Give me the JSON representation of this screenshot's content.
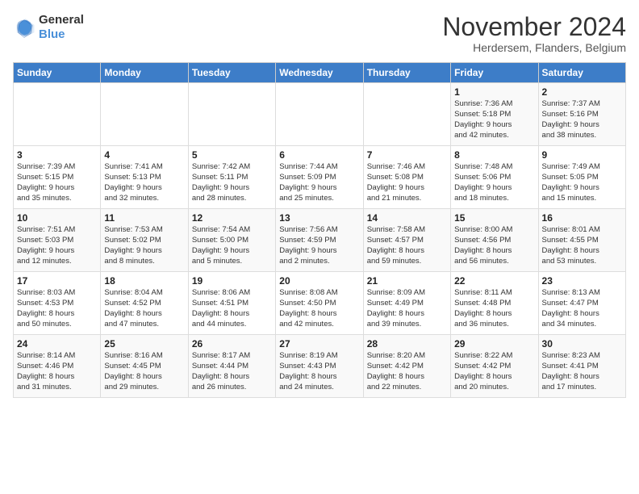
{
  "logo": {
    "line1": "General",
    "line2": "Blue"
  },
  "title": "November 2024",
  "subtitle": "Herdersem, Flanders, Belgium",
  "days_of_week": [
    "Sunday",
    "Monday",
    "Tuesday",
    "Wednesday",
    "Thursday",
    "Friday",
    "Saturday"
  ],
  "weeks": [
    [
      {
        "day": "",
        "info": ""
      },
      {
        "day": "",
        "info": ""
      },
      {
        "day": "",
        "info": ""
      },
      {
        "day": "",
        "info": ""
      },
      {
        "day": "",
        "info": ""
      },
      {
        "day": "1",
        "info": "Sunrise: 7:36 AM\nSunset: 5:18 PM\nDaylight: 9 hours\nand 42 minutes."
      },
      {
        "day": "2",
        "info": "Sunrise: 7:37 AM\nSunset: 5:16 PM\nDaylight: 9 hours\nand 38 minutes."
      }
    ],
    [
      {
        "day": "3",
        "info": "Sunrise: 7:39 AM\nSunset: 5:15 PM\nDaylight: 9 hours\nand 35 minutes."
      },
      {
        "day": "4",
        "info": "Sunrise: 7:41 AM\nSunset: 5:13 PM\nDaylight: 9 hours\nand 32 minutes."
      },
      {
        "day": "5",
        "info": "Sunrise: 7:42 AM\nSunset: 5:11 PM\nDaylight: 9 hours\nand 28 minutes."
      },
      {
        "day": "6",
        "info": "Sunrise: 7:44 AM\nSunset: 5:09 PM\nDaylight: 9 hours\nand 25 minutes."
      },
      {
        "day": "7",
        "info": "Sunrise: 7:46 AM\nSunset: 5:08 PM\nDaylight: 9 hours\nand 21 minutes."
      },
      {
        "day": "8",
        "info": "Sunrise: 7:48 AM\nSunset: 5:06 PM\nDaylight: 9 hours\nand 18 minutes."
      },
      {
        "day": "9",
        "info": "Sunrise: 7:49 AM\nSunset: 5:05 PM\nDaylight: 9 hours\nand 15 minutes."
      }
    ],
    [
      {
        "day": "10",
        "info": "Sunrise: 7:51 AM\nSunset: 5:03 PM\nDaylight: 9 hours\nand 12 minutes."
      },
      {
        "day": "11",
        "info": "Sunrise: 7:53 AM\nSunset: 5:02 PM\nDaylight: 9 hours\nand 8 minutes."
      },
      {
        "day": "12",
        "info": "Sunrise: 7:54 AM\nSunset: 5:00 PM\nDaylight: 9 hours\nand 5 minutes."
      },
      {
        "day": "13",
        "info": "Sunrise: 7:56 AM\nSunset: 4:59 PM\nDaylight: 9 hours\nand 2 minutes."
      },
      {
        "day": "14",
        "info": "Sunrise: 7:58 AM\nSunset: 4:57 PM\nDaylight: 8 hours\nand 59 minutes."
      },
      {
        "day": "15",
        "info": "Sunrise: 8:00 AM\nSunset: 4:56 PM\nDaylight: 8 hours\nand 56 minutes."
      },
      {
        "day": "16",
        "info": "Sunrise: 8:01 AM\nSunset: 4:55 PM\nDaylight: 8 hours\nand 53 minutes."
      }
    ],
    [
      {
        "day": "17",
        "info": "Sunrise: 8:03 AM\nSunset: 4:53 PM\nDaylight: 8 hours\nand 50 minutes."
      },
      {
        "day": "18",
        "info": "Sunrise: 8:04 AM\nSunset: 4:52 PM\nDaylight: 8 hours\nand 47 minutes."
      },
      {
        "day": "19",
        "info": "Sunrise: 8:06 AM\nSunset: 4:51 PM\nDaylight: 8 hours\nand 44 minutes."
      },
      {
        "day": "20",
        "info": "Sunrise: 8:08 AM\nSunset: 4:50 PM\nDaylight: 8 hours\nand 42 minutes."
      },
      {
        "day": "21",
        "info": "Sunrise: 8:09 AM\nSunset: 4:49 PM\nDaylight: 8 hours\nand 39 minutes."
      },
      {
        "day": "22",
        "info": "Sunrise: 8:11 AM\nSunset: 4:48 PM\nDaylight: 8 hours\nand 36 minutes."
      },
      {
        "day": "23",
        "info": "Sunrise: 8:13 AM\nSunset: 4:47 PM\nDaylight: 8 hours\nand 34 minutes."
      }
    ],
    [
      {
        "day": "24",
        "info": "Sunrise: 8:14 AM\nSunset: 4:46 PM\nDaylight: 8 hours\nand 31 minutes."
      },
      {
        "day": "25",
        "info": "Sunrise: 8:16 AM\nSunset: 4:45 PM\nDaylight: 8 hours\nand 29 minutes."
      },
      {
        "day": "26",
        "info": "Sunrise: 8:17 AM\nSunset: 4:44 PM\nDaylight: 8 hours\nand 26 minutes."
      },
      {
        "day": "27",
        "info": "Sunrise: 8:19 AM\nSunset: 4:43 PM\nDaylight: 8 hours\nand 24 minutes."
      },
      {
        "day": "28",
        "info": "Sunrise: 8:20 AM\nSunset: 4:42 PM\nDaylight: 8 hours\nand 22 minutes."
      },
      {
        "day": "29",
        "info": "Sunrise: 8:22 AM\nSunset: 4:42 PM\nDaylight: 8 hours\nand 20 minutes."
      },
      {
        "day": "30",
        "info": "Sunrise: 8:23 AM\nSunset: 4:41 PM\nDaylight: 8 hours\nand 17 minutes."
      }
    ]
  ]
}
